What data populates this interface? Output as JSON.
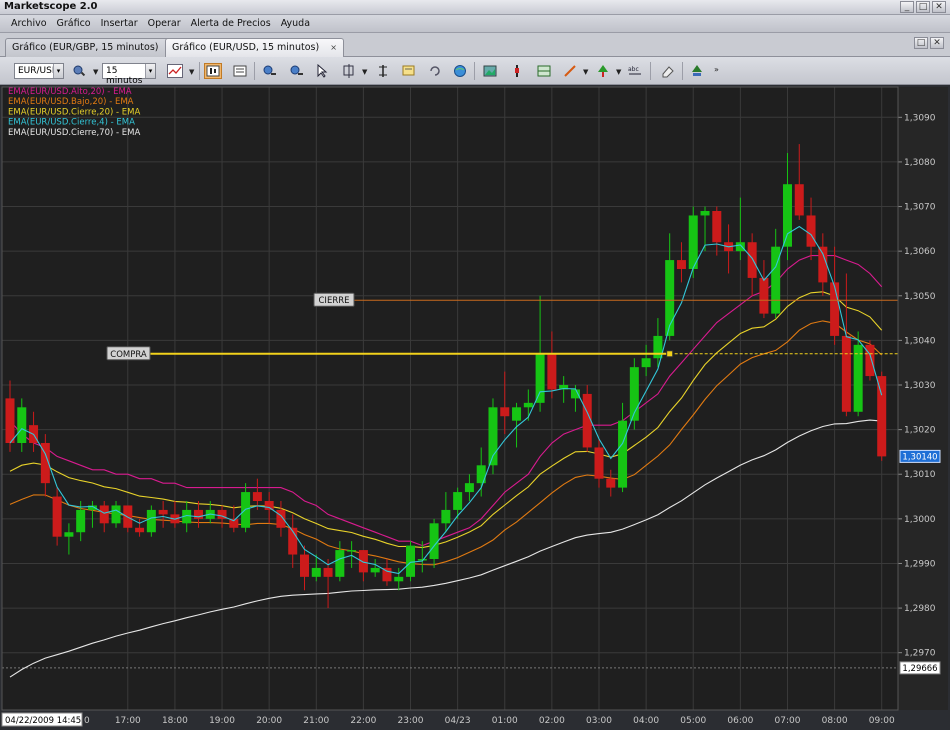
{
  "window": {
    "title": "Marketscope 2.0",
    "controls": [
      "_",
      "□",
      "✕"
    ]
  },
  "menu": [
    "Archivo",
    "Gráfico",
    "Insertar",
    "Operar",
    "Alerta de Precios",
    "Ayuda"
  ],
  "tabs": [
    {
      "label": "Gráfico (EUR/GBP, 15 minutos)",
      "close": "×",
      "active": false
    },
    {
      "label": "Gráfico (EUR/USD, 15 minutos)",
      "close": "×",
      "active": true
    }
  ],
  "toolbar": {
    "symbol": "EUR/USD",
    "timeframe": "15 minutos",
    "icons": [
      "magnifier-settings-icon",
      "line-chart-icon",
      "candle-view-icon",
      "table-view-icon",
      "zoom-in-icon",
      "zoom-out-icon",
      "cursor-icon",
      "crosshair-icon",
      "text-note-icon",
      "refresh-icon",
      "globe-icon",
      "picture-icon",
      "indicator-icon",
      "grid-icon",
      "pen-draw-icon",
      "trend-icon",
      "abc-icon",
      "eraser-icon",
      "tree-icon"
    ]
  },
  "colors": {
    "background": "#1f1f1f",
    "up_candle": "#16c414",
    "down_candle": "#cc1b1b",
    "grid": "#3a3a3a",
    "ema_alto_20": "#d81b8f",
    "ema_bajo_20": "#e07a12",
    "ema_cierre_20": "#e8d22a",
    "ema_cierre_4": "#33c7d9",
    "ema_cierre_70": "#e6e6e6",
    "compra_line": "#f2d21b",
    "cierre_line": "#c86a1e"
  },
  "chart_data": {
    "type": "candlestick",
    "legend": [
      {
        "label": "EMA(EUR/USD.Alto,20) - EMA",
        "color": "#d81b8f"
      },
      {
        "label": "EMA(EUR/USD.Bajo,20) - EMA",
        "color": "#e07a12"
      },
      {
        "label": "EMA(EUR/USD.Cierre,20) - EMA",
        "color": "#e8d22a"
      },
      {
        "label": "EMA(EUR/USD.Cierre,4) - EMA",
        "color": "#33c7d9"
      },
      {
        "label": "EMA(EUR/USD.Cierre,70) - EMA",
        "color": "#e6e6e6"
      }
    ],
    "y_ticks": [
      "1,3090",
      "1,3080",
      "1,3070",
      "1,3060",
      "1,3050",
      "1,3040",
      "1,3030",
      "1,3020",
      "1,3010",
      "1,3000",
      "1,2990",
      "1,2980",
      "1,2970"
    ],
    "ylim": [
      1.2962,
      1.3097
    ],
    "x_ticks": [
      "17:00",
      "18:00",
      "19:00",
      "20:00",
      "21:00",
      "22:00",
      "23:00",
      "04/23",
      "01:00",
      "02:00",
      "03:00",
      "04:00",
      "05:00",
      "06:00",
      "07:00",
      "08:00",
      "09:00"
    ],
    "x_tick_index": [
      10,
      14,
      18,
      22,
      26,
      30,
      34,
      38,
      42,
      46,
      50,
      54,
      58,
      62,
      66,
      70,
      74
    ],
    "x_start_label": "04/22/2009 14:45",
    "x_start_partial": "0",
    "current_price": "1,30140",
    "bottom_price": "1,29666",
    "bottom_price_value": 1.29666,
    "compra": {
      "label": "COMPRA",
      "price": 1.3037,
      "start_index": 56
    },
    "cierre": {
      "label": "CIERRE",
      "price": 1.3049
    },
    "ohlc": [
      [
        1.3027,
        1.3031,
        1.3015,
        1.3017
      ],
      [
        1.3017,
        1.3027,
        1.3015,
        1.3025
      ],
      [
        1.3021,
        1.3024,
        1.3015,
        1.3017
      ],
      [
        1.3017,
        1.3019,
        1.3005,
        1.3008
      ],
      [
        1.3005,
        1.3007,
        1.2994,
        1.2996
      ],
      [
        1.2996,
        1.2999,
        1.2992,
        1.2997
      ],
      [
        1.2997,
        1.3004,
        1.2995,
        1.3002
      ],
      [
        1.3002,
        1.3004,
        1.2998,
        1.3003
      ],
      [
        1.3003,
        1.3004,
        1.2997,
        1.2999
      ],
      [
        1.2999,
        1.3004,
        1.2998,
        1.3003
      ],
      [
        1.3003,
        1.3003,
        1.2997,
        1.2998
      ],
      [
        1.2998,
        1.3,
        1.2996,
        1.2997
      ],
      [
        1.2997,
        1.3003,
        1.2996,
        1.3002
      ],
      [
        1.3002,
        1.3004,
        1.2998,
        1.3001
      ],
      [
        1.3001,
        1.3004,
        1.2998,
        1.2999
      ],
      [
        1.2999,
        1.3004,
        1.2997,
        1.3002
      ],
      [
        1.3002,
        1.3004,
        1.2998,
        1.3
      ],
      [
        1.3,
        1.3004,
        1.2999,
        1.3002
      ],
      [
        1.3002,
        1.3003,
        1.2998,
        1.3
      ],
      [
        1.3,
        1.3003,
        1.2997,
        1.2998
      ],
      [
        1.2998,
        1.3008,
        1.2997,
        1.3006
      ],
      [
        1.3006,
        1.3009,
        1.3002,
        1.3004
      ],
      [
        1.3004,
        1.3006,
        1.2999,
        1.3002
      ],
      [
        1.3002,
        1.3004,
        1.2996,
        1.2998
      ],
      [
        1.2998,
        1.3001,
        1.2989,
        1.2992
      ],
      [
        1.2992,
        1.2994,
        1.2984,
        1.2987
      ],
      [
        1.2987,
        1.2992,
        1.2986,
        1.2989
      ],
      [
        1.2989,
        1.2991,
        1.298,
        1.2987
      ],
      [
        1.2987,
        1.2995,
        1.2986,
        1.2993
      ],
      [
        1.2993,
        1.2995,
        1.2989,
        1.2993
      ],
      [
        1.2993,
        1.2993,
        1.2986,
        1.2988
      ],
      [
        1.2988,
        1.2991,
        1.2987,
        1.2989
      ],
      [
        1.2989,
        1.2991,
        1.2985,
        1.2986
      ],
      [
        1.2986,
        1.2989,
        1.2984,
        1.2987
      ],
      [
        1.2987,
        1.2995,
        1.2986,
        1.2994
      ],
      [
        1.2991,
        1.2995,
        1.2988,
        1.2991
      ],
      [
        1.2991,
        1.3,
        1.2989,
        1.2999
      ],
      [
        1.2999,
        1.3006,
        1.2997,
        1.3002
      ],
      [
        1.3002,
        1.3007,
        1.3,
        1.3006
      ],
      [
        1.3006,
        1.301,
        1.3004,
        1.3008
      ],
      [
        1.3008,
        1.3016,
        1.3005,
        1.3012
      ],
      [
        1.3012,
        1.3027,
        1.301,
        1.3025
      ],
      [
        1.3025,
        1.3033,
        1.3019,
        1.3023
      ],
      [
        1.3022,
        1.3026,
        1.3016,
        1.3025
      ],
      [
        1.3025,
        1.3029,
        1.3022,
        1.3026
      ],
      [
        1.3026,
        1.305,
        1.3024,
        1.3037
      ],
      [
        1.3037,
        1.3042,
        1.3027,
        1.3029
      ],
      [
        1.3029,
        1.3032,
        1.3026,
        1.303
      ],
      [
        1.3027,
        1.303,
        1.3024,
        1.3029
      ],
      [
        1.3028,
        1.303,
        1.3015,
        1.3016
      ],
      [
        1.3016,
        1.3018,
        1.3007,
        1.3009
      ],
      [
        1.3009,
        1.3011,
        1.3005,
        1.3007
      ],
      [
        1.3007,
        1.3026,
        1.3006,
        1.3022
      ],
      [
        1.3022,
        1.3036,
        1.302,
        1.3034
      ],
      [
        1.3034,
        1.3039,
        1.3032,
        1.3036
      ],
      [
        1.3036,
        1.3045,
        1.3034,
        1.3041
      ],
      [
        1.3041,
        1.3064,
        1.304,
        1.3058
      ],
      [
        1.3058,
        1.3062,
        1.3053,
        1.3056
      ],
      [
        1.3056,
        1.307,
        1.3054,
        1.3068
      ],
      [
        1.3068,
        1.307,
        1.306,
        1.3069
      ],
      [
        1.3069,
        1.307,
        1.3059,
        1.3062
      ],
      [
        1.3062,
        1.3066,
        1.3055,
        1.306
      ],
      [
        1.306,
        1.3072,
        1.3058,
        1.3062
      ],
      [
        1.3062,
        1.3064,
        1.305,
        1.3054
      ],
      [
        1.3054,
        1.3058,
        1.3045,
        1.3046
      ],
      [
        1.3046,
        1.3065,
        1.3045,
        1.3061
      ],
      [
        1.3061,
        1.3082,
        1.3058,
        1.3075
      ],
      [
        1.3075,
        1.3084,
        1.3067,
        1.3068
      ],
      [
        1.3068,
        1.3072,
        1.3058,
        1.3061
      ],
      [
        1.3061,
        1.3064,
        1.305,
        1.3053
      ],
      [
        1.3053,
        1.3061,
        1.3039,
        1.3041
      ],
      [
        1.3041,
        1.3055,
        1.3023,
        1.3024
      ],
      [
        1.3024,
        1.3042,
        1.3023,
        1.3039
      ],
      [
        1.3039,
        1.304,
        1.3031,
        1.3032
      ],
      [
        1.3032,
        1.3033,
        1.3013,
        1.3014
      ]
    ],
    "ema_alto_20": [
      1.3022,
      1.3019,
      1.3017,
      1.3016,
      1.3014,
      1.3013,
      1.3012,
      1.3011,
      1.3011,
      1.301,
      1.301,
      1.3009,
      1.3009,
      1.3008,
      1.3008,
      1.3007,
      1.3007,
      1.3007,
      1.3007,
      1.3007,
      1.3007,
      1.3007,
      1.3007,
      1.3007,
      1.3006,
      1.3004,
      1.3003,
      1.3001,
      1.3,
      1.2999,
      1.2998,
      1.2997,
      1.2996,
      1.2995,
      1.2995,
      1.2994,
      1.2995,
      1.2996,
      1.2997,
      1.2998,
      1.3,
      1.3003,
      1.3006,
      1.3008,
      1.301,
      1.3014,
      1.3017,
      1.3019,
      1.302,
      1.3021,
      1.3021,
      1.3021,
      1.3022,
      1.3024,
      1.3026,
      1.3028,
      1.3032,
      1.3035,
      1.3038,
      1.3041,
      1.3044,
      1.3046,
      1.3048,
      1.305,
      1.3051,
      1.3053,
      1.3056,
      1.3058,
      1.3059,
      1.3059,
      1.3059,
      1.3058,
      1.3057,
      1.3055,
      1.3052
    ]
  }
}
